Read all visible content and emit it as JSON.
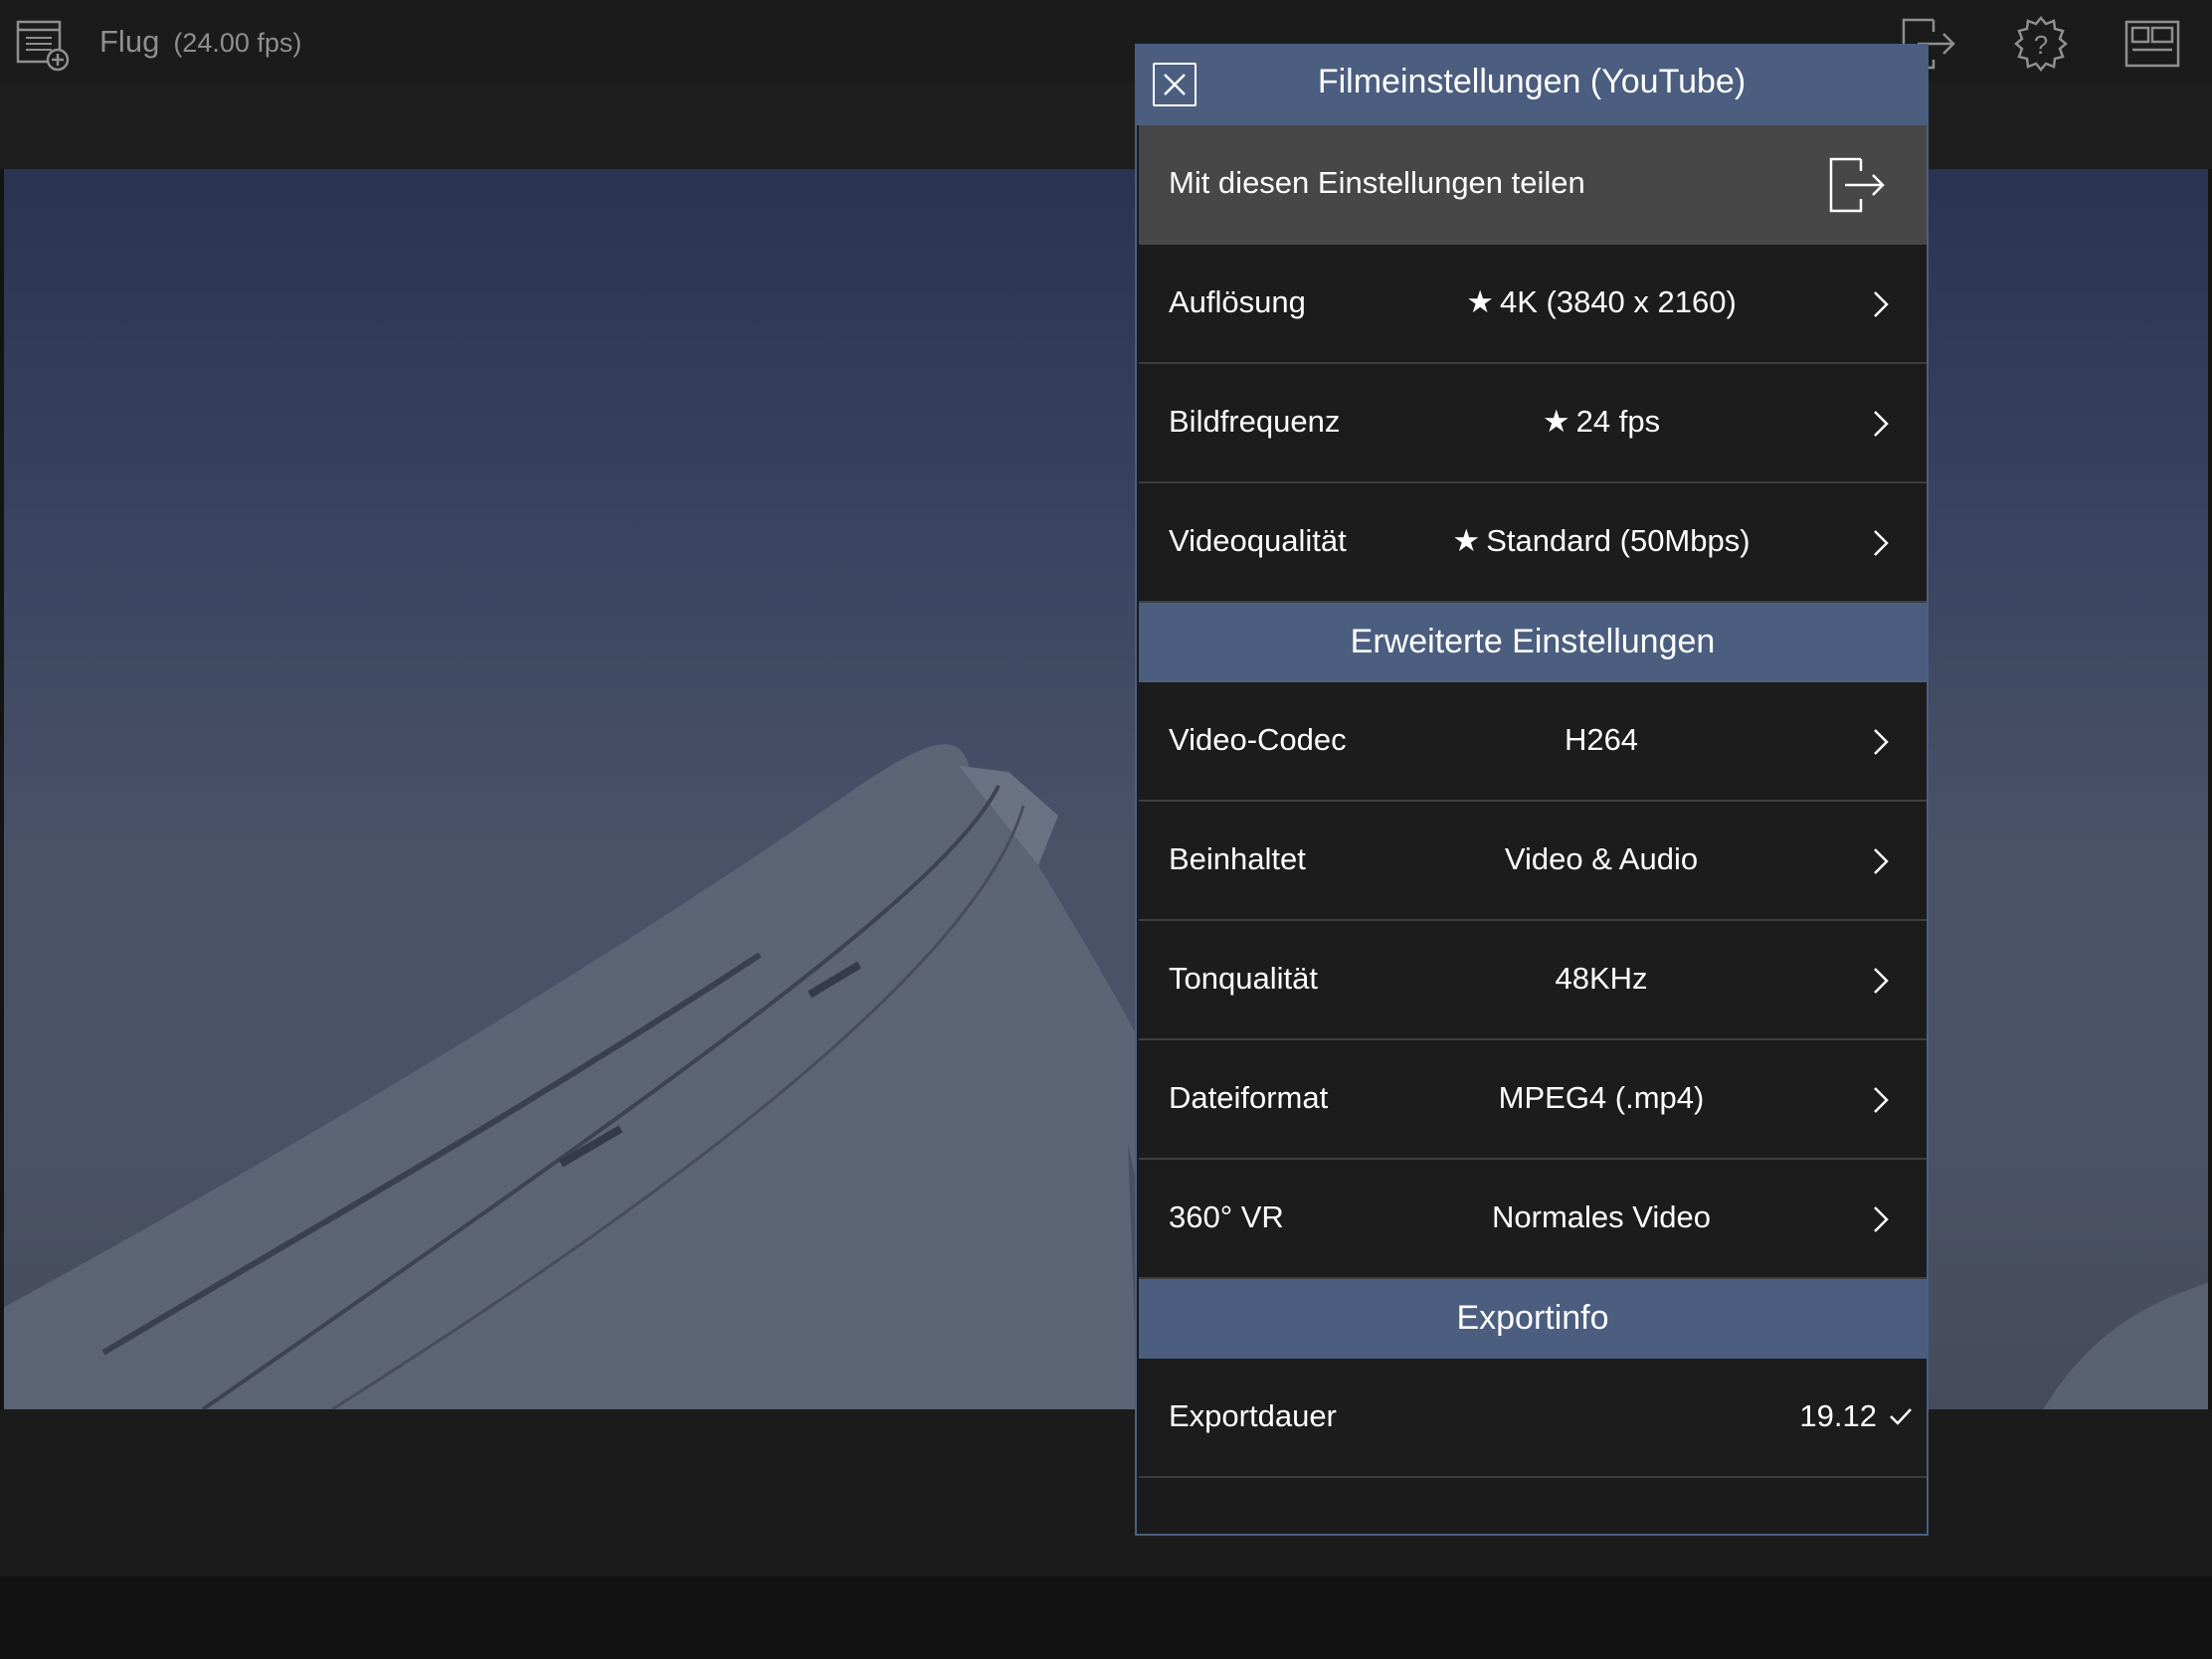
{
  "toolbar": {
    "project_name": "Flug",
    "project_fps": "(24.00 fps)",
    "icons": [
      "project-list-icon",
      "export-icon",
      "help-gear-icon",
      "layout-icon"
    ]
  },
  "dialog": {
    "title": "Filmeinstellungen (YouTube)",
    "share": {
      "label": "Mit diesen Einstellungen teilen",
      "icon": "share-export-icon"
    },
    "settings": [
      {
        "label": "Auflösung",
        "value": "4K (3840 x 2160)",
        "starred": true
      },
      {
        "label": "Bildfrequenz",
        "value": "24 fps",
        "starred": true
      },
      {
        "label": "Videoqualität",
        "value": "Standard (50Mbps)",
        "starred": true
      }
    ],
    "advanced": {
      "title": "Erweiterte Einstellungen",
      "items": [
        {
          "label": "Video-Codec",
          "value": "H264"
        },
        {
          "label": "Beinhaltet",
          "value": "Video & Audio"
        },
        {
          "label": "Tonqualität",
          "value": "48KHz"
        },
        {
          "label": "Dateiformat",
          "value": "MPEG4 (.mp4)"
        },
        {
          "label": "360° VR",
          "value": "Normales Video"
        }
      ]
    },
    "export_info": {
      "title": "Exportinfo",
      "duration_label": "Exportdauer",
      "duration_value": "19.12"
    },
    "star_glyph": "★"
  },
  "colors": {
    "header_blue": "#4b5e80",
    "panel_bg": "#1c1c1c",
    "share_row_bg": "#474747"
  }
}
